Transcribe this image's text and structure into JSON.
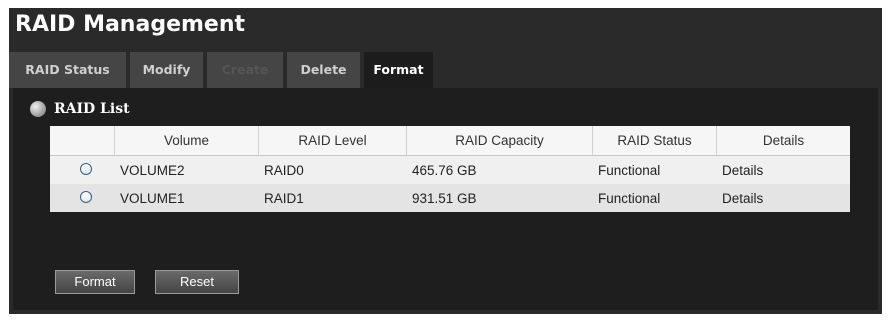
{
  "page_title": "RAID Management",
  "tabs": [
    {
      "label": "RAID Status",
      "state": "normal"
    },
    {
      "label": "Modify",
      "state": "normal"
    },
    {
      "label": "Create",
      "state": "disabled"
    },
    {
      "label": "Delete",
      "state": "normal"
    },
    {
      "label": "Format",
      "state": "active"
    }
  ],
  "raid_list": {
    "title": "RAID List",
    "columns": [
      "",
      "Volume",
      "RAID Level",
      "RAID Capacity",
      "RAID Status",
      "Details"
    ],
    "rows": [
      {
        "volume": "VOLUME2",
        "level": "RAID0",
        "capacity": "465.76 GB",
        "status": "Functional",
        "details": "Details"
      },
      {
        "volume": "VOLUME1",
        "level": "RAID1",
        "capacity": "931.51 GB",
        "status": "Functional",
        "details": "Details"
      }
    ]
  },
  "buttons": {
    "format": "Format",
    "reset": "Reset"
  }
}
